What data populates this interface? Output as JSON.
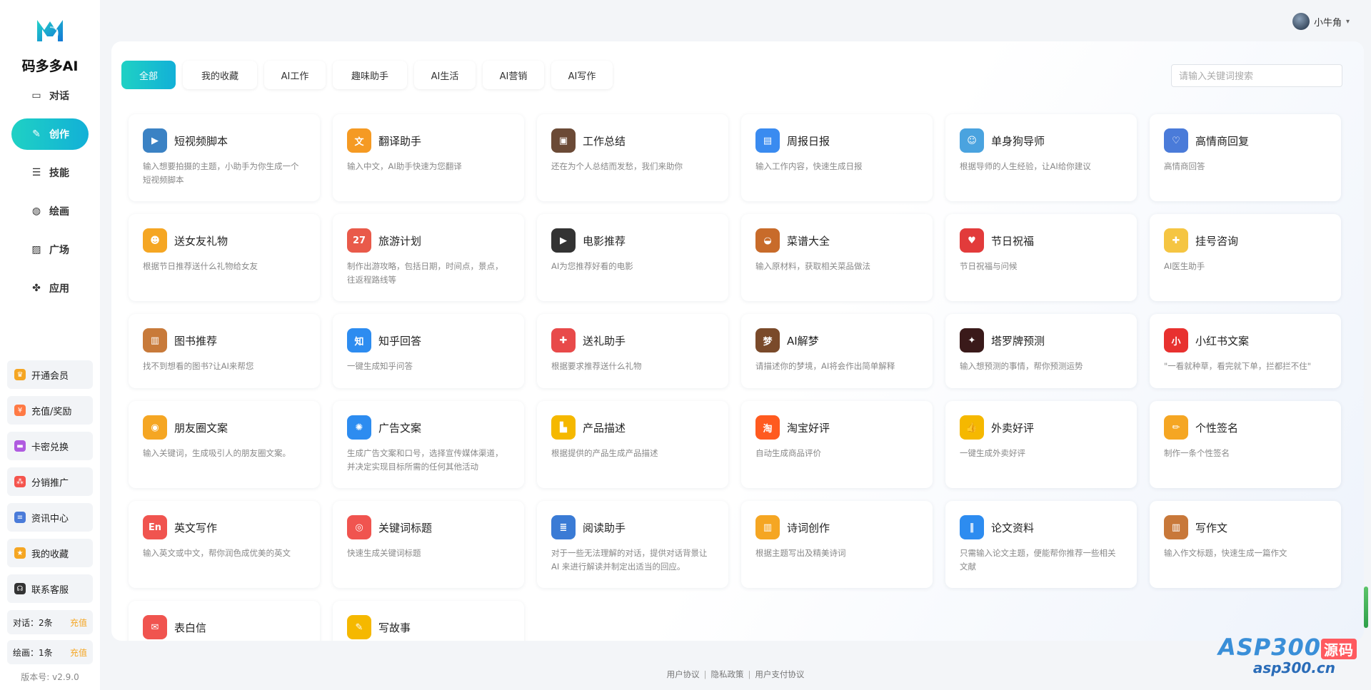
{
  "app": {
    "name": "码多多AI",
    "version": "版本号: v2.9.0",
    "accent": "#17bfd0"
  },
  "nav": [
    {
      "label": "对话",
      "icon": "chat-icon"
    },
    {
      "label": "创作",
      "icon": "pen-icon",
      "active": true
    },
    {
      "label": "技能",
      "icon": "list-icon"
    },
    {
      "label": "绘画",
      "icon": "palette-icon"
    },
    {
      "label": "广场",
      "icon": "image-icon"
    },
    {
      "label": "应用",
      "icon": "apps-icon"
    }
  ],
  "side_buttons": [
    {
      "label": "开通会员",
      "icon": "vip-icon",
      "color": "#f5a623"
    },
    {
      "label": "充值/奖励",
      "icon": "recharge-icon",
      "color": "#ff7a45"
    },
    {
      "label": "卡密兑换",
      "icon": "card-icon",
      "color": "#b05be0"
    },
    {
      "label": "分销推广",
      "icon": "distribution-icon",
      "color": "#f5544d"
    },
    {
      "label": "资讯中心",
      "icon": "news-icon",
      "color": "#4a7bd9"
    },
    {
      "label": "我的收藏",
      "icon": "star-icon",
      "color": "#f5a623"
    },
    {
      "label": "联系客服",
      "icon": "headset-icon",
      "color": "#333333"
    }
  ],
  "counts": [
    {
      "label": "对话：2条",
      "action": "充值"
    },
    {
      "label": "绘画：1条",
      "action": "充值"
    }
  ],
  "user": {
    "name": "小牛角"
  },
  "tabs": [
    "全部",
    "我的收藏",
    "AI工作",
    "趣味助手",
    "AI生活",
    "AI营销",
    "AI写作"
  ],
  "search": {
    "placeholder": "请输入关键词搜索"
  },
  "cards": [
    {
      "title": "短视频脚本",
      "desc": "输入想要拍摄的主题，小助手为你生成一个短视频脚本",
      "icon": "clapperboard-icon",
      "color": "#3b82c4"
    },
    {
      "title": "翻译助手",
      "desc": "输入中文，AI助手快速为您翻译",
      "icon": "translate-icon",
      "color": "#f59a23"
    },
    {
      "title": "工作总结",
      "desc": "还在为个人总结而发愁，我们来助你",
      "icon": "briefcase-icon",
      "color": "#6b4a36"
    },
    {
      "title": "周报日报",
      "desc": "输入工作内容，快速生成日报",
      "icon": "calendar-report-icon",
      "color": "#3a8bf0"
    },
    {
      "title": "单身狗导师",
      "desc": "根据导师的人生经验，让AI给你建议",
      "icon": "id-card-icon",
      "color": "#4aa3df"
    },
    {
      "title": "高情商回复",
      "desc": "高情商回答",
      "icon": "heart-chat-icon",
      "color": "#4a7bd9"
    },
    {
      "title": "送女友礼物",
      "desc": "根据节日推荐送什么礼物给女友",
      "icon": "couple-icon",
      "color": "#f5a623"
    },
    {
      "title": "旅游计划",
      "desc": "制作出游攻略，包括日期，时间点，景点，往返程路线等",
      "icon": "calendar-27-icon",
      "color": "#e95a4a"
    },
    {
      "title": "电影推荐",
      "desc": "AI为您推荐好看的电影",
      "icon": "film-icon",
      "color": "#333333"
    },
    {
      "title": "菜谱大全",
      "desc": "输入原材料，获取相关菜品做法",
      "icon": "cooking-pot-icon",
      "color": "#c86b2a"
    },
    {
      "title": "节日祝福",
      "desc": "节日祝福与问候",
      "icon": "heart-bubble-icon",
      "color": "#e23b3b"
    },
    {
      "title": "挂号咨询",
      "desc": "AI医生助手",
      "icon": "nurse-icon",
      "color": "#f5c542"
    },
    {
      "title": "图书推荐",
      "desc": "找不到想看的图书?让AI来帮您",
      "icon": "book-icon",
      "color": "#c87a3a"
    },
    {
      "title": "知乎回答",
      "desc": "一键生成知乎问答",
      "icon": "zhihu-icon",
      "color": "#2d8cf0"
    },
    {
      "title": "送礼助手",
      "desc": "根据要求推荐送什么礼物",
      "icon": "gift-icon",
      "color": "#e84a4a"
    },
    {
      "title": "AI解梦",
      "desc": "请描述你的梦境，AI将会作出简单解释",
      "icon": "dream-icon",
      "color": "#7a4a2a"
    },
    {
      "title": "塔罗牌预测",
      "desc": "输入想预测的事情，帮你预测运势",
      "icon": "tarot-icon",
      "color": "#3a1a1a"
    },
    {
      "title": "小红书文案",
      "desc": "\"一看就种草，看完就下单，拦都拦不住\"",
      "icon": "xiaohongshu-icon",
      "color": "#e8312f"
    },
    {
      "title": "朋友圈文案",
      "desc": "输入关键词，生成吸引人的朋友圈文案。",
      "icon": "aperture-icon",
      "color": "#f5a623"
    },
    {
      "title": "广告文案",
      "desc": "生成广告文案和口号，选择宣传媒体渠道，并决定实现目标所需的任何其他活动",
      "icon": "ad-icon",
      "color": "#2d8cf0"
    },
    {
      "title": "产品描述",
      "desc": "根据提供的产品生成产品描述",
      "icon": "shopping-bag-icon",
      "color": "#f5b800"
    },
    {
      "title": "淘宝好评",
      "desc": "自动生成商品评价",
      "icon": "taobao-icon",
      "color": "#ff5a1f"
    },
    {
      "title": "外卖好评",
      "desc": "一键生成外卖好评",
      "icon": "thumbs-up-icon",
      "color": "#f5b800"
    },
    {
      "title": "个性签名",
      "desc": "制作一条个性签名",
      "icon": "pencil-icon",
      "color": "#f5a623"
    },
    {
      "title": "英文写作",
      "desc": "输入英文或中文，帮你润色成优美的英文",
      "icon": "english-icon",
      "color": "#f0544f"
    },
    {
      "title": "关键词标题",
      "desc": "快速生成关键词标题",
      "icon": "keyword-icon",
      "color": "#f0544f"
    },
    {
      "title": "阅读助手",
      "desc": "对于一些无法理解的对话，提供对话背景让 AI 来进行解读并制定出适当的回应。",
      "icon": "books-stack-icon",
      "color": "#3a7bd5"
    },
    {
      "title": "诗词创作",
      "desc": "根据主题写出及精美诗词",
      "icon": "open-book-icon",
      "color": "#f5a623"
    },
    {
      "title": "论文资料",
      "desc": "只需输入论文主题，便能帮你推荐一些相关文献",
      "icon": "binders-icon",
      "color": "#2d8cf0"
    },
    {
      "title": "写作文",
      "desc": "输入作文标题，快速生成一篇作文",
      "icon": "notebook-icon",
      "color": "#c8783a"
    },
    {
      "title": "表白信",
      "desc": "",
      "icon": "love-letter-icon",
      "color": "#f0544f"
    },
    {
      "title": "写故事",
      "desc": "",
      "icon": "story-icon",
      "color": "#f5b800"
    }
  ],
  "footer": {
    "links": [
      "用户协议",
      "隐私政策",
      "用户支付协议"
    ]
  },
  "watermark": {
    "brand": "ASP300",
    "badge": "源码",
    "url": "asp300.cn"
  }
}
